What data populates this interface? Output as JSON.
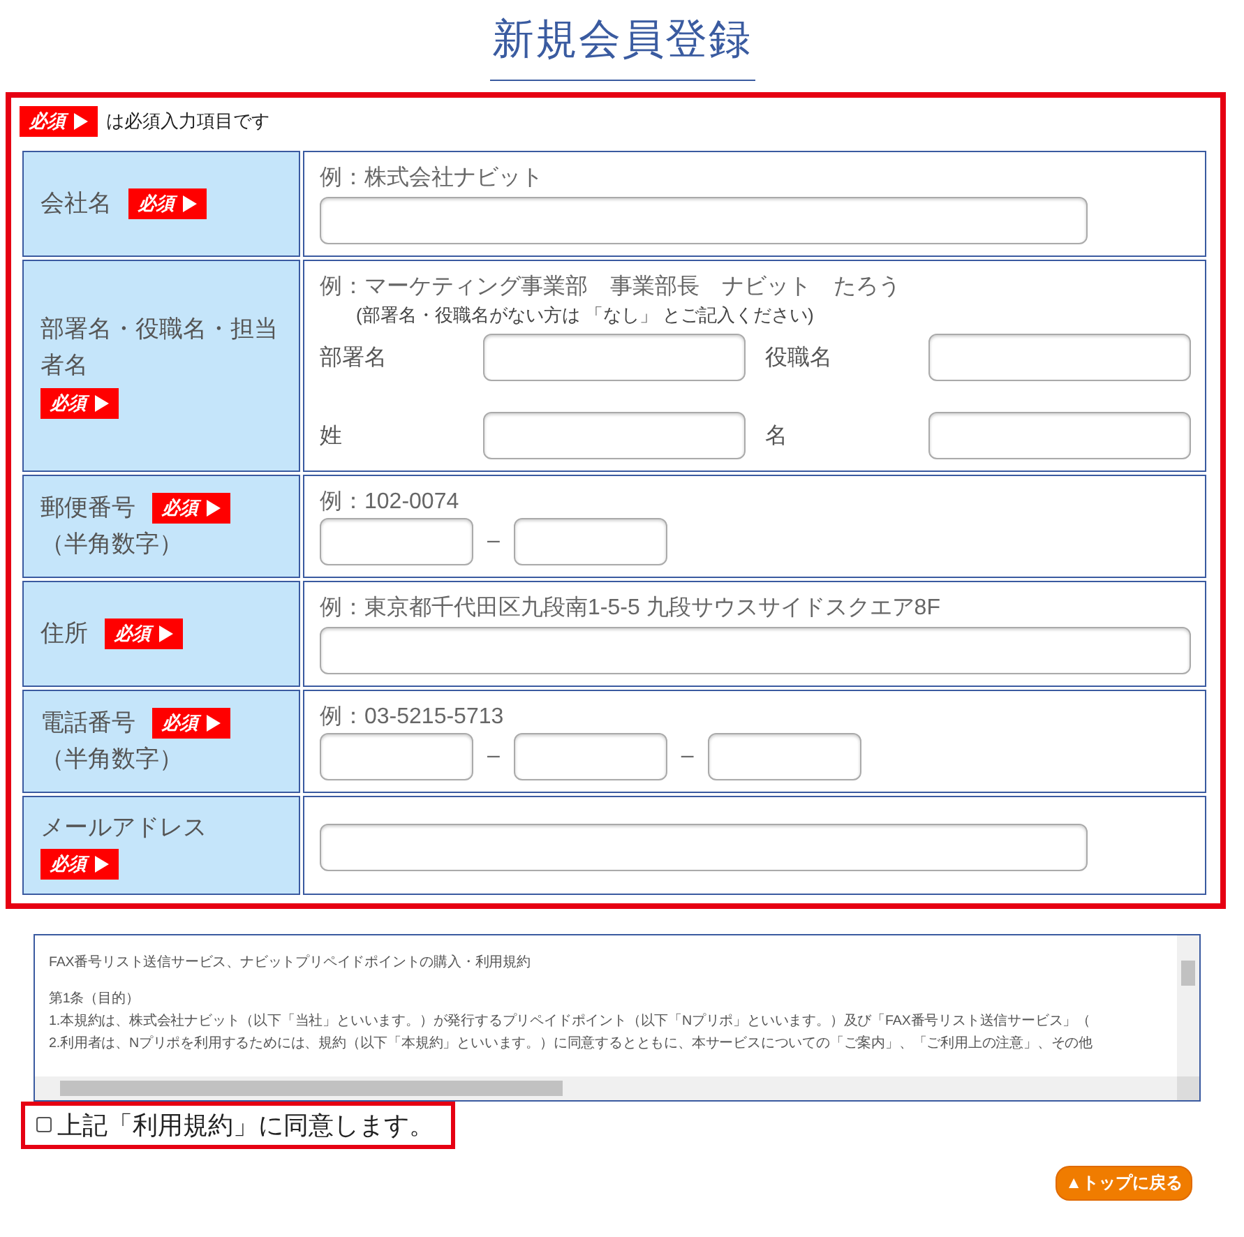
{
  "title": "新規会員登録",
  "legend": {
    "badge": "必須",
    "text": "は必須入力項目です"
  },
  "rows": [
    {
      "label": "会社名",
      "badge": "必須",
      "kind": "single",
      "hint": "例：株式会社ナビット"
    },
    {
      "label": "部署名・役職名・担当者名",
      "badge": "必須",
      "kind": "grid",
      "hint": "例：マーケティング事業部　事業部長　ナビット　たろう",
      "note": "(部署名・役職名がない方は 「なし」 とご記入ください)",
      "fields": [
        {
          "label": "部署名"
        },
        {
          "label": "役職名"
        },
        {
          "label": "姓"
        },
        {
          "label": "名"
        }
      ]
    },
    {
      "label": "郵便番号",
      "sublabel": "（半角数字）",
      "badge": "必須",
      "kind": "split",
      "hint": "例：102-0074",
      "separators": [
        "–"
      ]
    },
    {
      "label": "住所",
      "badge": "必須",
      "kind": "full",
      "hint": "例：東京都千代田区九段南1-5-5 九段サウスサイドスクエア8F"
    },
    {
      "label": "電話番号",
      "sublabel": "（半角数字）",
      "badge": "必須",
      "kind": "split",
      "hint": "例：03-5215-5713",
      "separators": [
        "–",
        "–"
      ]
    },
    {
      "label": "メールアドレス",
      "badge": "必須",
      "badge_below": true,
      "kind": "single"
    }
  ],
  "terms": {
    "title": "FAX番号リスト送信サービス、ナビットプリペイドポイントの購入・利用規約",
    "lines": [
      "第1条（目的）",
      "1.本規約は、株式会社ナビット（以下「当社」といいます。）が発行するプリペイドポイント（以下「Nプリポ」といいます。）及び「FAX番号リスト送信サービス」（",
      "2.利用者は、Nプリポを利用するためには、規約（以下「本規約」といいます。）に同意するとともに、本サービスについての「ご案内」、「ご利用上の注意」、その他"
    ]
  },
  "agree": {
    "label": "上記「利用規約」に同意します。",
    "checked": false
  },
  "top_button": "▲トップに戻る"
}
